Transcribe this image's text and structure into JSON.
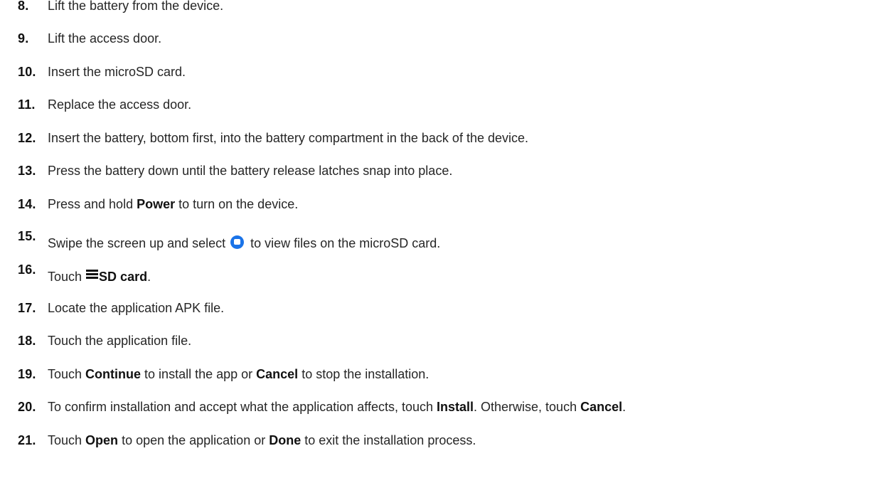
{
  "steps": [
    {
      "num": "8.",
      "parts": [
        {
          "t": "Lift the battery from the device."
        }
      ]
    },
    {
      "num": "9.",
      "parts": [
        {
          "t": "Lift the access door."
        }
      ]
    },
    {
      "num": "10.",
      "parts": [
        {
          "t": "Insert the microSD card."
        }
      ]
    },
    {
      "num": "11.",
      "parts": [
        {
          "t": "Replace the access door."
        }
      ]
    },
    {
      "num": "12.",
      "parts": [
        {
          "t": "Insert the battery, bottom first, into the battery compartment in the back of the device."
        }
      ]
    },
    {
      "num": "13.",
      "parts": [
        {
          "t": "Press the battery down until the battery release latches snap into place."
        }
      ]
    },
    {
      "num": "14.",
      "parts": [
        {
          "t": "Press and hold "
        },
        {
          "t": "Power",
          "b": true
        },
        {
          "t": " to turn on the device."
        }
      ]
    },
    {
      "num": "15.",
      "parts": [
        {
          "t": "Swipe the screen up and select "
        },
        {
          "icon": "files-app-icon"
        },
        {
          "t": " to view files on the microSD card."
        }
      ]
    },
    {
      "num": "16.",
      "parts": [
        {
          "t": "Touch"
        },
        {
          "icon": "menu-icon"
        },
        {
          "t": "SD card",
          "b": true
        },
        {
          "t": "."
        }
      ]
    },
    {
      "num": "17.",
      "parts": [
        {
          "t": "Locate the application APK file."
        }
      ]
    },
    {
      "num": "18.",
      "parts": [
        {
          "t": "Touch the application file."
        }
      ]
    },
    {
      "num": "19.",
      "parts": [
        {
          "t": "Touch "
        },
        {
          "t": "Continue",
          "b": true
        },
        {
          "t": " to install the app or "
        },
        {
          "t": "Cancel",
          "b": true
        },
        {
          "t": " to stop the installation."
        }
      ]
    },
    {
      "num": "20.",
      "parts": [
        {
          "t": "To confirm installation and accept what the application affects, touch "
        },
        {
          "t": "Install",
          "b": true
        },
        {
          "t": ". Otherwise, touch "
        },
        {
          "t": "Cancel",
          "b": true
        },
        {
          "t": "."
        }
      ]
    },
    {
      "num": "21.",
      "parts": [
        {
          "t": "Touch "
        },
        {
          "t": "Open",
          "b": true
        },
        {
          "t": " to open the application or "
        },
        {
          "t": "Done",
          "b": true
        },
        {
          "t": " to exit the installation process."
        }
      ]
    }
  ],
  "colors": {
    "text": "#262626",
    "number": "#111111",
    "files_icon": "#1a73e8"
  }
}
